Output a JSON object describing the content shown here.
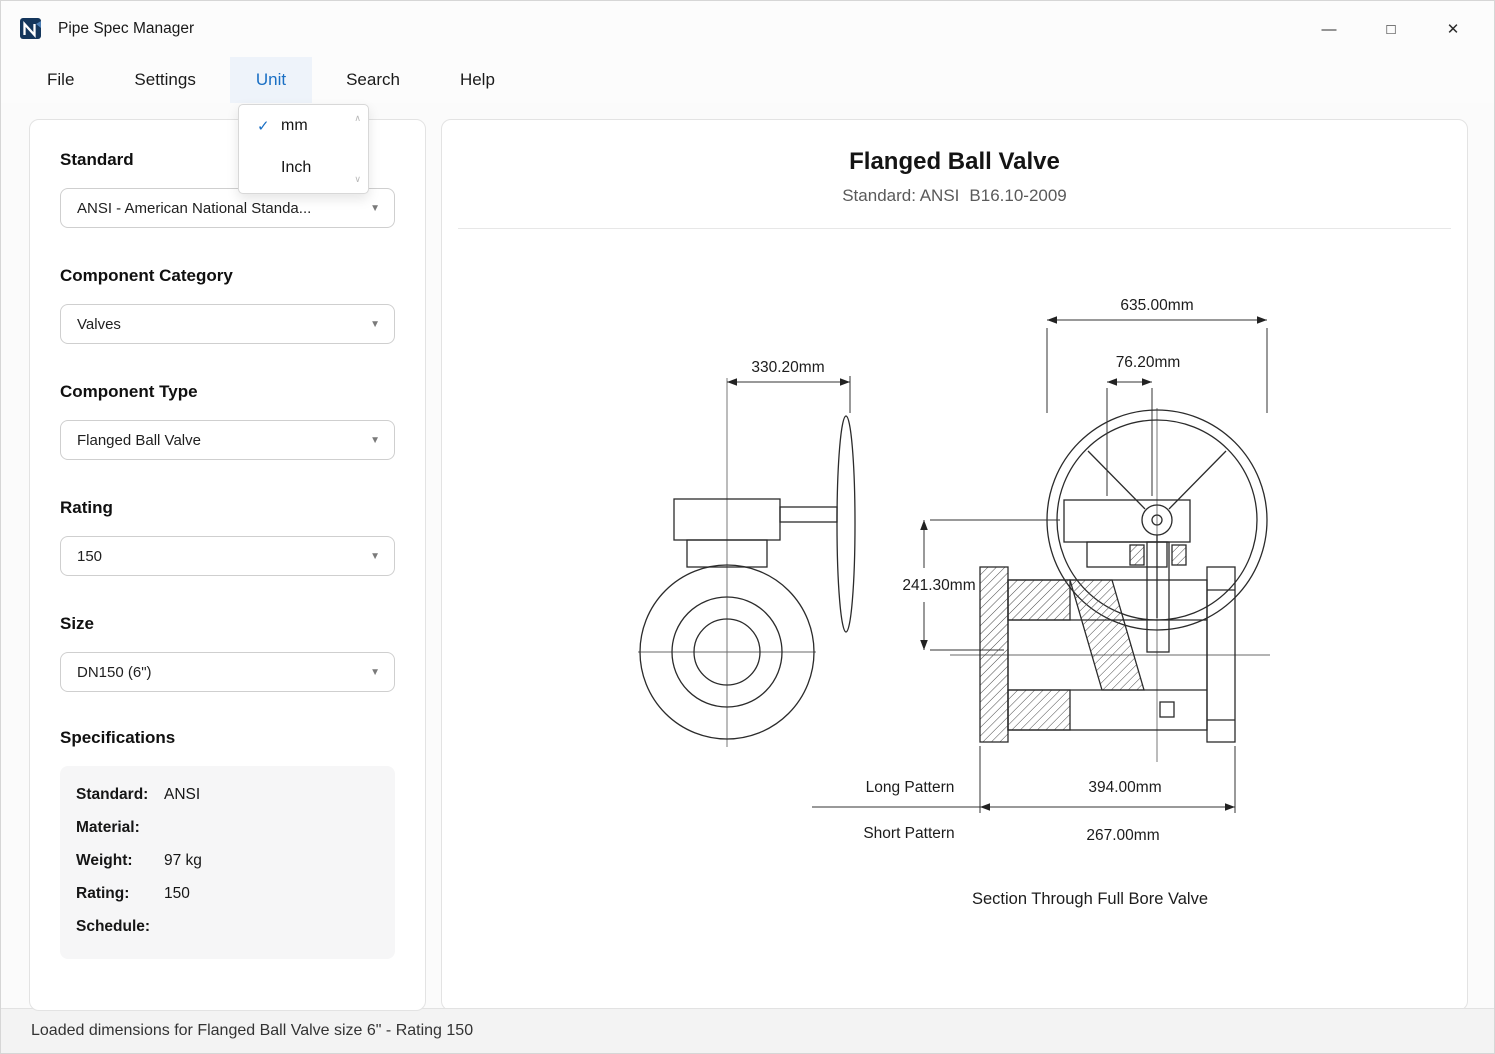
{
  "window": {
    "title": "Pipe Spec Manager",
    "controls": {
      "minimize": "—",
      "maximize": "□",
      "close": "✕"
    }
  },
  "glyphs": {
    "caret": "▼",
    "check": "✓",
    "scroll_up": "∧",
    "scroll_down": "∨"
  },
  "menu": {
    "items": [
      {
        "label": "File"
      },
      {
        "label": "Settings"
      },
      {
        "label": "Unit",
        "active": true
      },
      {
        "label": "Search"
      },
      {
        "label": "Help"
      }
    ]
  },
  "unit_menu": {
    "options": [
      {
        "label": "mm",
        "checked": true
      },
      {
        "label": "Inch",
        "checked": false
      }
    ]
  },
  "sidebar": {
    "fields": [
      {
        "label": "Standard",
        "value": "ANSI - American National Standa..."
      },
      {
        "label": "Component Category",
        "value": "Valves"
      },
      {
        "label": "Component Type",
        "value": "Flanged Ball Valve"
      },
      {
        "label": "Rating",
        "value": "150"
      },
      {
        "label": "Size",
        "value": "DN150 (6\")"
      }
    ],
    "specifications": {
      "title": "Specifications",
      "rows": [
        {
          "label": "Standard:",
          "value": "ANSI"
        },
        {
          "label": "Material:",
          "value": ""
        },
        {
          "label": "Weight:",
          "value": "97 kg"
        },
        {
          "label": "Rating:",
          "value": "150"
        },
        {
          "label": "Schedule:",
          "value": ""
        }
      ]
    }
  },
  "main": {
    "title": "Flanged Ball Valve",
    "subtitle_standard": "Standard: ANSI",
    "subtitle_code": "B16.10-2009",
    "drawing": {
      "dim_front_width": "330.20mm",
      "dim_top_width": "635.00mm",
      "dim_hub_width": "76.20mm",
      "dim_height": "241.30mm",
      "label_long_pattern": "Long Pattern",
      "dim_long_pattern": "394.00mm",
      "label_short_pattern": "Short Pattern",
      "dim_short_pattern": "267.00mm",
      "caption": "Section Through Full Bore Valve"
    }
  },
  "status": {
    "text": "Loaded dimensions for Flanged Ball Valve size 6\" - Rating 150"
  }
}
